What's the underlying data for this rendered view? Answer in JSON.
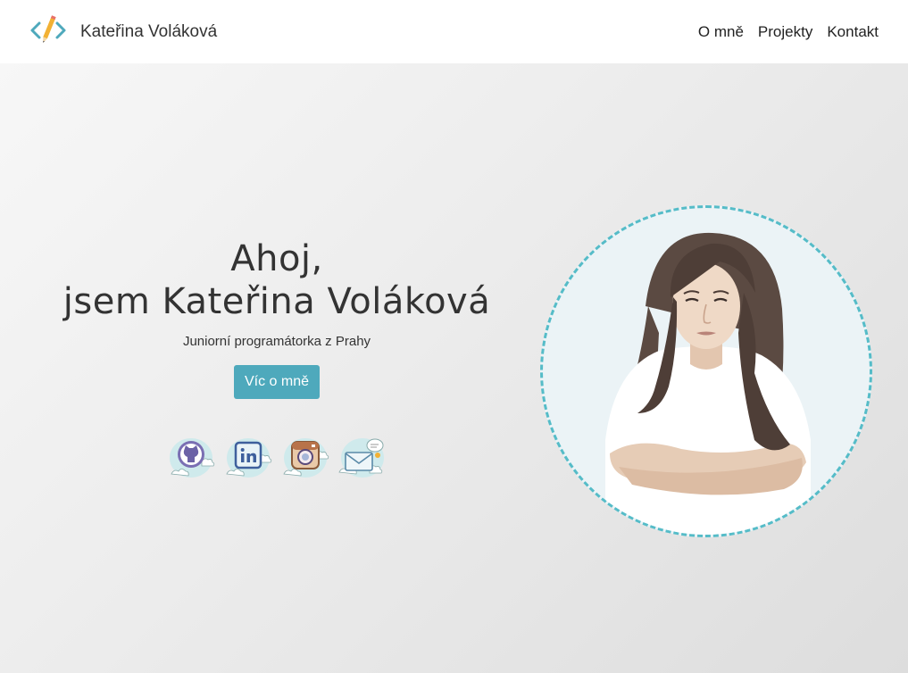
{
  "navbar": {
    "brand_name": "Kateřina Voláková",
    "logo_icon": "code-pencil-icon",
    "links": [
      {
        "label": "O mně"
      },
      {
        "label": "Projekty"
      },
      {
        "label": "Kontakt"
      }
    ]
  },
  "hero": {
    "greeting_line1": "Ahoj,",
    "greeting_line2": "jsem Kateřina Voláková",
    "subtitle": "Juniorní programátorka z Prahy",
    "cta_label": "Víc o mně",
    "social_icons": [
      "github-icon",
      "linkedin-icon",
      "instagram-icon",
      "email-icon"
    ],
    "portrait": "portrait-illustration"
  },
  "colors": {
    "accent": "#4ea9bc",
    "circle_border": "#55bcc8",
    "text": "#333333"
  }
}
